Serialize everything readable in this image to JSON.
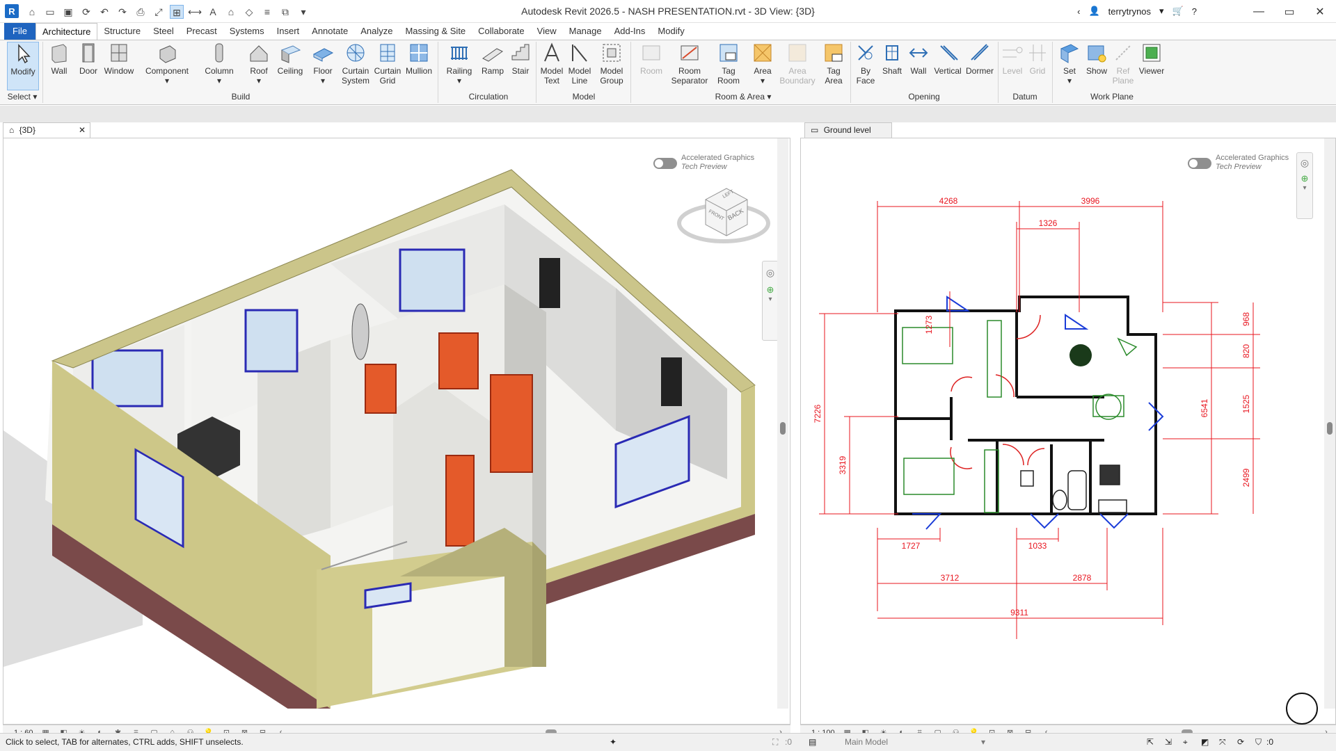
{
  "window": {
    "title": "Autodesk Revit 2026.5 - NASH PRESENTATION.rvt - 3D View: {3D}",
    "user": "terrytrynos",
    "app_letter": "R"
  },
  "tabs": [
    "File",
    "Architecture",
    "Structure",
    "Steel",
    "Precast",
    "Systems",
    "Insert",
    "Annotate",
    "Analyze",
    "Massing & Site",
    "Collaborate",
    "View",
    "Manage",
    "Add-Ins",
    "Modify"
  ],
  "active_tab": "Architecture",
  "ribbon": {
    "select": {
      "modify": "Modify",
      "panel": "Select"
    },
    "build": {
      "wall": "Wall",
      "door": "Door",
      "window": "Window",
      "component": "Component",
      "column": "Column",
      "roof": "Roof",
      "ceiling": "Ceiling",
      "floor": "Floor",
      "curtain_system_1": "Curtain",
      "curtain_system_2": "System",
      "curtain_grid_1": "Curtain",
      "curtain_grid_2": "Grid",
      "mullion": "Mullion",
      "panel": "Build"
    },
    "circulation": {
      "railing": "Railing",
      "ramp": "Ramp",
      "stair": "Stair",
      "panel": "Circulation"
    },
    "model": {
      "text_1": "Model",
      "text_2": "Text",
      "line_1": "Model",
      "line_2": "Line",
      "group_1": "Model",
      "group_2": "Group",
      "panel": "Model"
    },
    "room": {
      "room": "Room",
      "separator_1": "Room",
      "separator_2": "Separator",
      "tag_room_1": "Tag",
      "tag_room_2": "Room",
      "area": "Area",
      "boundary_1": "Area",
      "boundary_2": "Boundary",
      "tag_area_1": "Tag",
      "tag_area_2": "Area",
      "panel": "Room & Area"
    },
    "opening": {
      "byface_1": "By",
      "byface_2": "Face",
      "shaft": "Shaft",
      "wall": "Wall",
      "vertical": "Vertical",
      "dormer": "Dormer",
      "panel": "Opening"
    },
    "datum": {
      "level": "Level",
      "grid": "Grid",
      "panel": "Datum"
    },
    "workplane": {
      "set": "Set",
      "show": "Show",
      "refplane_1": "Ref",
      "refplane_2": "Plane",
      "viewer": "Viewer",
      "panel": "Work Plane"
    }
  },
  "views": {
    "left": {
      "tab": "{3D}",
      "scale": "1 : 60",
      "ag_title": "Accelerated Graphics",
      "ag_sub": "Tech Preview",
      "cube_top": "LEFT",
      "cube_front": "FRONT",
      "cube_back": "BACK"
    },
    "right": {
      "tab": "Ground level",
      "scale": "1 : 100",
      "ag_title": "Accelerated Graphics",
      "ag_sub": "Tech Preview"
    }
  },
  "dimensions": {
    "top_1": "4268",
    "top_2": "3996",
    "top_3": "1326",
    "r_1": "968",
    "r_2": "820",
    "r_3": "1525",
    "r_4": "6541",
    "r_5": "2499",
    "l_1": "7226",
    "l_2": "3319",
    "i_1": "1273",
    "b_1": "1727",
    "b_2": "1033",
    "b_3": "3712",
    "b_4": "2878",
    "b_5": "9311"
  },
  "status": {
    "hint": "Click to select, TAB for alternates, CTRL adds, SHIFT unselects.",
    "model": "Main Model",
    "sel_count": ":0",
    "filter_count": ":0"
  },
  "colors": {
    "accent": "#1f64bf",
    "dim": "#e8141e",
    "wall_ext": "#cdc788",
    "brick": "#7a4a4a"
  }
}
